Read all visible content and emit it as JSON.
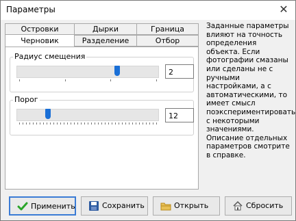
{
  "window": {
    "title": "Параметры"
  },
  "tabs": {
    "row1": [
      "Островки",
      "Дырки",
      "Граница"
    ],
    "row2": [
      "Черновик",
      "Разделение",
      "Отбор"
    ]
  },
  "groups": {
    "radius": {
      "label": "Радиус смещения",
      "value": "2",
      "slider_fraction": 0.73
    },
    "threshold": {
      "label": "Порог",
      "value": "12",
      "slider_fraction": 0.2
    }
  },
  "description": "Заданные параметры влияют на точность определения объекта. Если фотографии смазаны или сделаны не с ручными настройками, а с автоматическими, то имеет смысл поэкспериментировать с некоторыми значениями. Описание отдельных параметров смотрите в справке.",
  "buttons": {
    "apply": "Применить",
    "save": "Сохранить",
    "open": "Открыть",
    "reset": "Сбросить"
  },
  "icons": {
    "apply": "checkmark-icon",
    "save": "floppy-icon",
    "open": "folder-icon",
    "reset": "home-icon",
    "close": "close-icon"
  }
}
